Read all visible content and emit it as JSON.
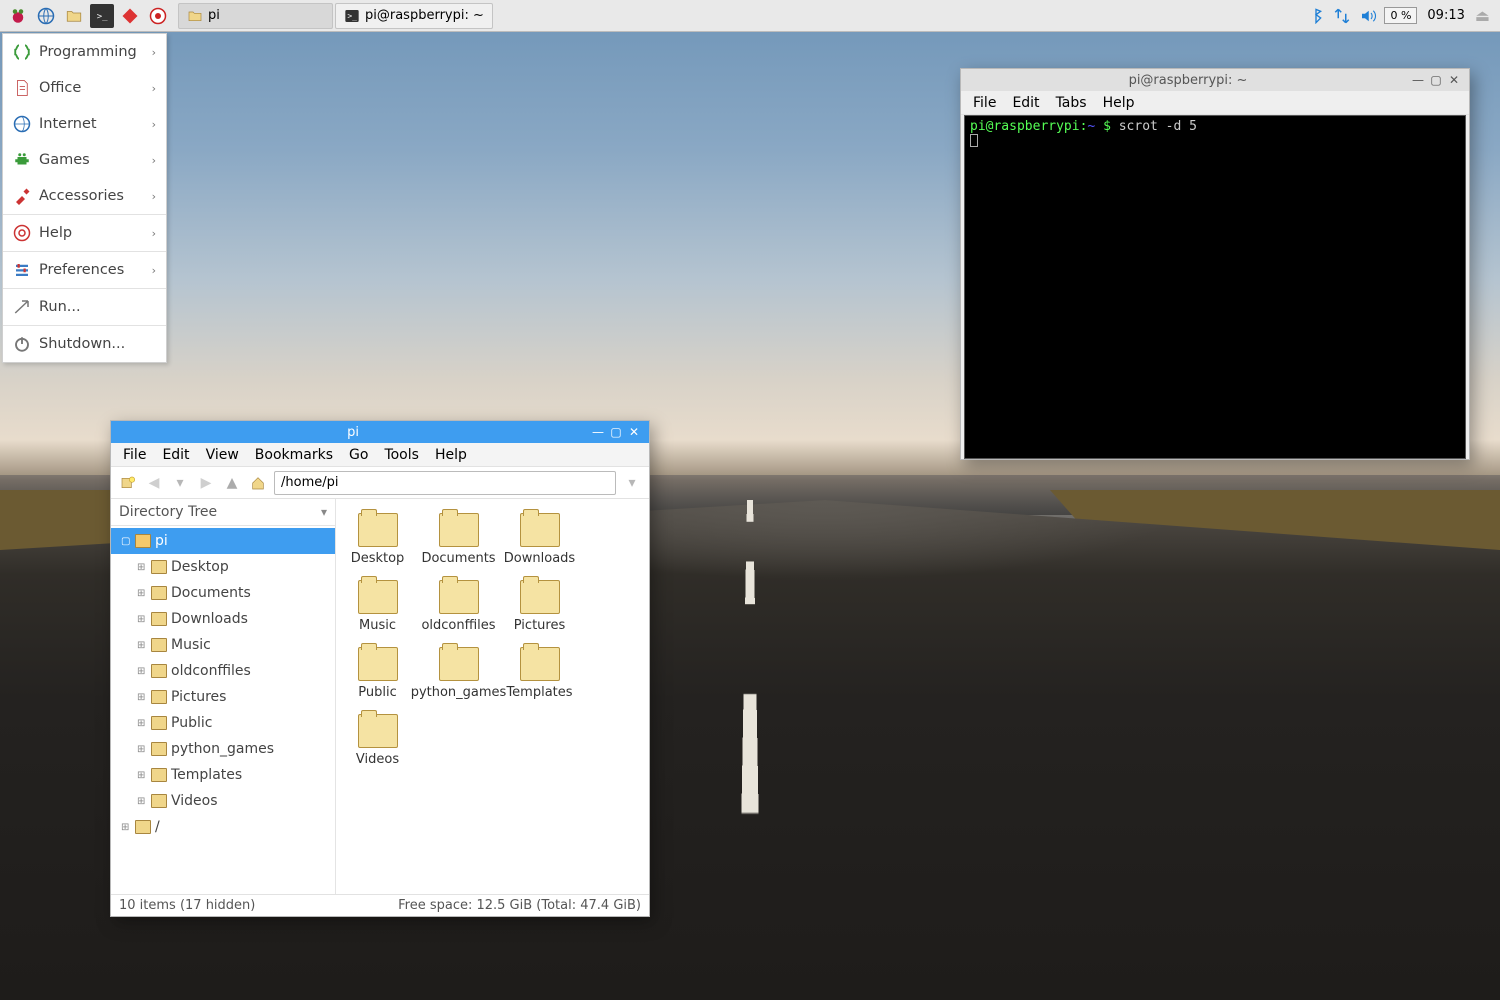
{
  "taskbar": {
    "tasks": [
      {
        "label": "pi",
        "active": true
      },
      {
        "label": "pi@raspberrypi: ~",
        "active": false
      }
    ],
    "cpu": "0 %",
    "clock": "09:13"
  },
  "appmenu": {
    "groups": [
      {
        "label": "Programming",
        "submenu": true
      },
      {
        "label": "Office",
        "submenu": true
      },
      {
        "label": "Internet",
        "submenu": true
      },
      {
        "label": "Games",
        "submenu": true
      },
      {
        "label": "Accessories",
        "submenu": true
      }
    ],
    "help": {
      "label": "Help",
      "submenu": true
    },
    "prefs": {
      "label": "Preferences",
      "submenu": true
    },
    "run": {
      "label": "Run..."
    },
    "shutdown": {
      "label": "Shutdown..."
    }
  },
  "fm": {
    "title": "pi",
    "menus": [
      "File",
      "Edit",
      "View",
      "Bookmarks",
      "Go",
      "Tools",
      "Help"
    ],
    "path": "/home/pi",
    "side_header": "Directory Tree",
    "tree": {
      "root": "pi",
      "children": [
        "Desktop",
        "Documents",
        "Downloads",
        "Music",
        "oldconffiles",
        "Pictures",
        "Public",
        "python_games",
        "Templates",
        "Videos"
      ],
      "fsroot": "/"
    },
    "items": [
      "Desktop",
      "Documents",
      "Downloads",
      "Music",
      "oldconffiles",
      "Pictures",
      "Public",
      "python_games",
      "Templates",
      "Videos"
    ],
    "status_left": "10 items (17 hidden)",
    "status_right": "Free space: 12.5 GiB (Total: 47.4 GiB)"
  },
  "term": {
    "title": "pi@raspberrypi: ~",
    "menus": [
      "File",
      "Edit",
      "Tabs",
      "Help"
    ],
    "prompt_user": "pi@raspberrypi",
    "prompt_path": "~",
    "prompt_symbol": "$",
    "command": "scrot -d 5"
  }
}
